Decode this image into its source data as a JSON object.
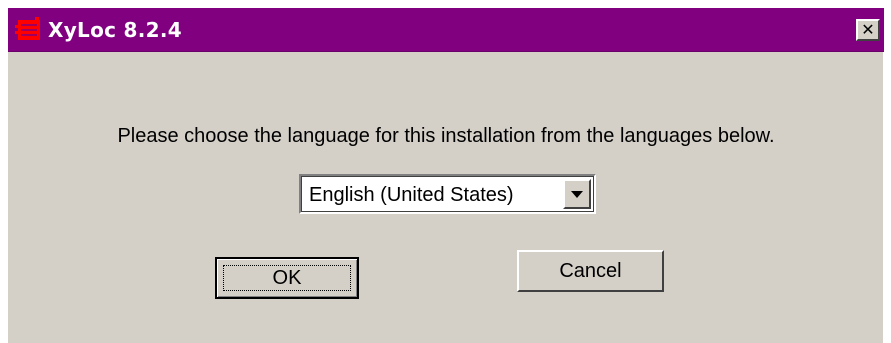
{
  "window": {
    "title": "XyLoc 8.2.4",
    "close_glyph": "✕",
    "icon": "app-icon",
    "title_bar_color": "#800080"
  },
  "dialog": {
    "message": "Please choose the language for this installation from the languages below.",
    "language_select": {
      "selected": "English (United States)"
    },
    "buttons": {
      "ok_label": "OK",
      "cancel_label": "Cancel"
    }
  }
}
